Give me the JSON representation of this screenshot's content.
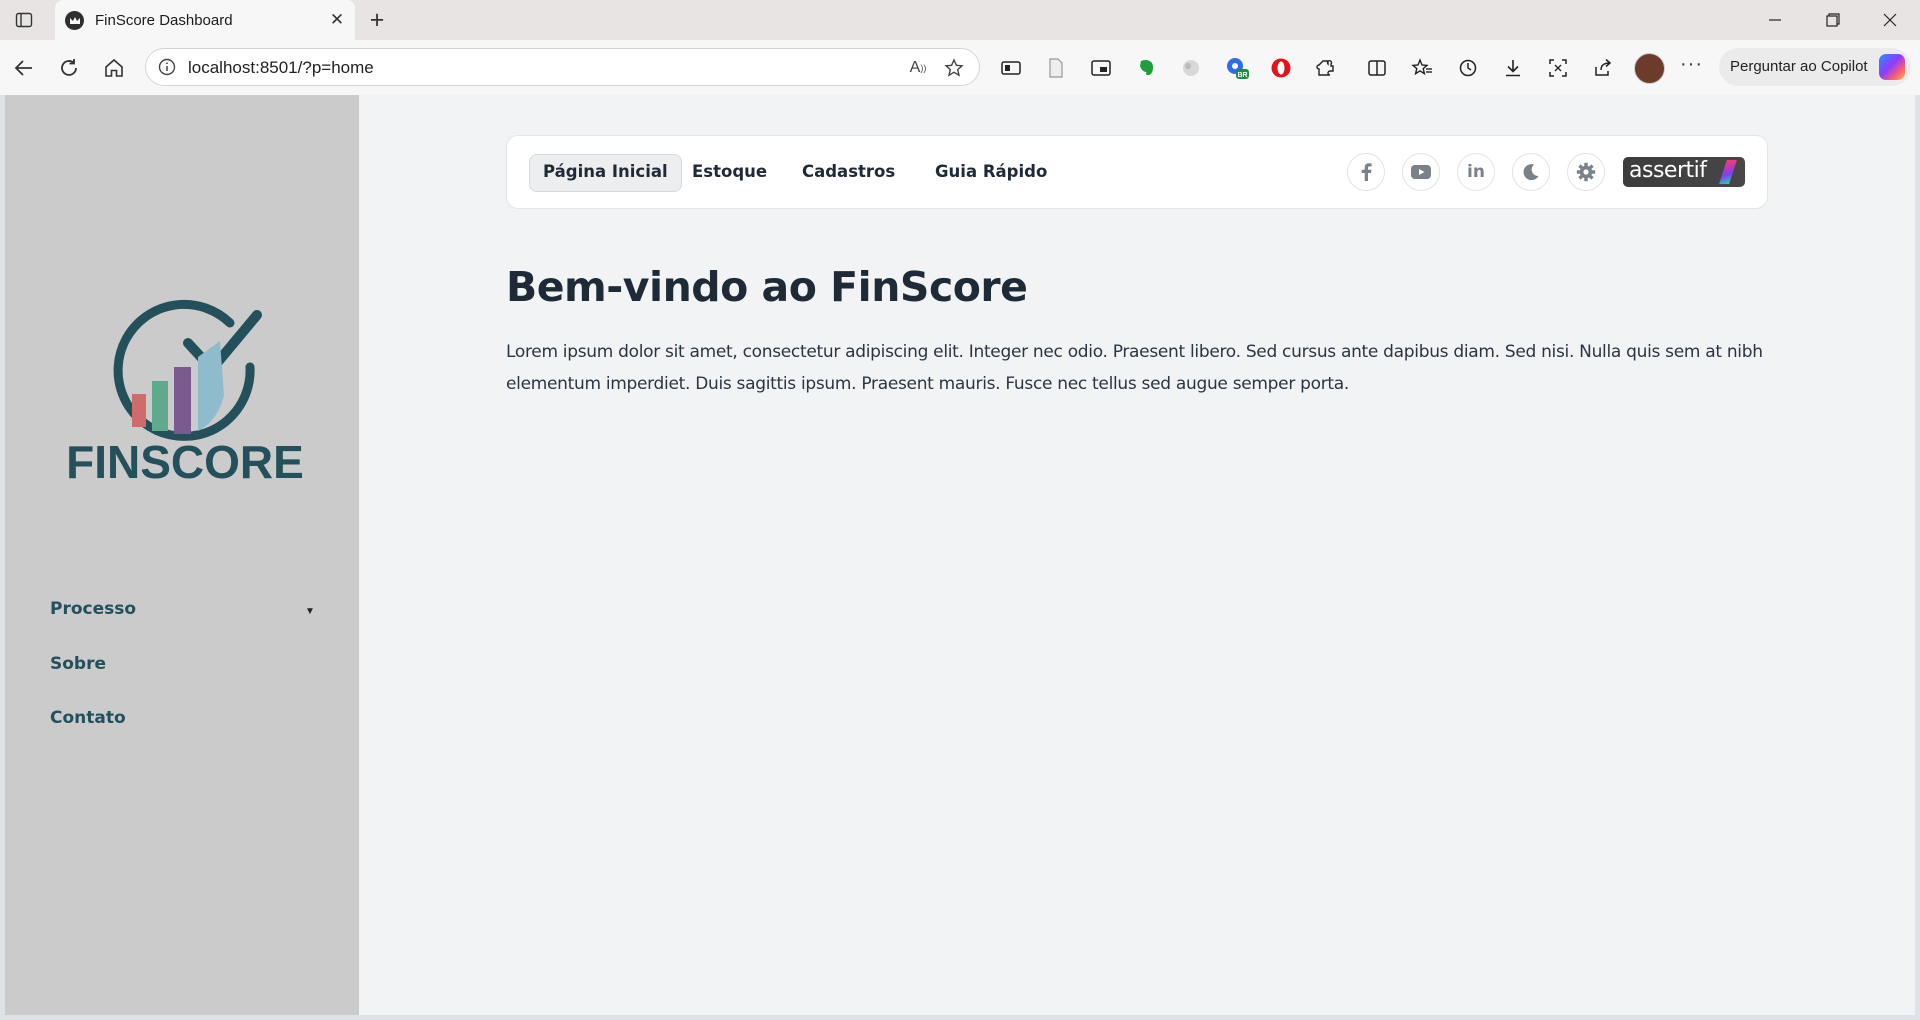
{
  "browser": {
    "tab": {
      "title": "FinScore Dashboard"
    },
    "address": {
      "url": "localhost:8501/?p=home"
    },
    "copilot_label": "Perguntar ao Copilot",
    "extension_badge": "BR",
    "icons": [
      "tab-actions-icon",
      "back-icon",
      "refresh-icon",
      "home-icon",
      "info-icon",
      "read-aloud-icon",
      "favorite-star-icon",
      "immersive-reader-icon",
      "document-icon",
      "picture-in-picture-icon",
      "evernote-icon",
      "extension-icon",
      "vpn-icon",
      "opera-icon",
      "puzzle-icon",
      "split-screen-icon",
      "favorites-icon",
      "history-icon",
      "download-icon",
      "screenshot-icon",
      "share-icon",
      "more-icon"
    ]
  },
  "sidebar": {
    "logo": {
      "wordmark": "FINSCORE",
      "colors": {
        "primary": "#23505a",
        "bar1": "#cf6b6b",
        "bar2": "#5fa98c",
        "bar3": "#7a5a8f",
        "bar4": "#8fbccc"
      }
    },
    "items": [
      {
        "label": "Processo",
        "has_dropdown": true
      },
      {
        "label": "Sobre"
      },
      {
        "label": "Contato"
      }
    ]
  },
  "navbar": {
    "links": [
      {
        "label": "Página Inicial",
        "active": true
      },
      {
        "label": "Estoque"
      },
      {
        "label": "Cadastros"
      },
      {
        "label": "Guia Rápido"
      }
    ],
    "icons": [
      "facebook-icon",
      "youtube-icon",
      "linkedin-icon",
      "moon-icon",
      "gear-icon"
    ],
    "brand": "assertif"
  },
  "main": {
    "title": "Bem-vindo ao FinScore",
    "body": "Lorem ipsum dolor sit amet, consectetur adipiscing elit. Integer nec odio. Praesent libero. Sed cursus ante dapibus diam. Sed nisi. Nulla quis sem at nibh elementum imperdiet. Duis sagittis ipsum. Praesent mauris. Fusce nec tellus sed augue semper porta."
  }
}
